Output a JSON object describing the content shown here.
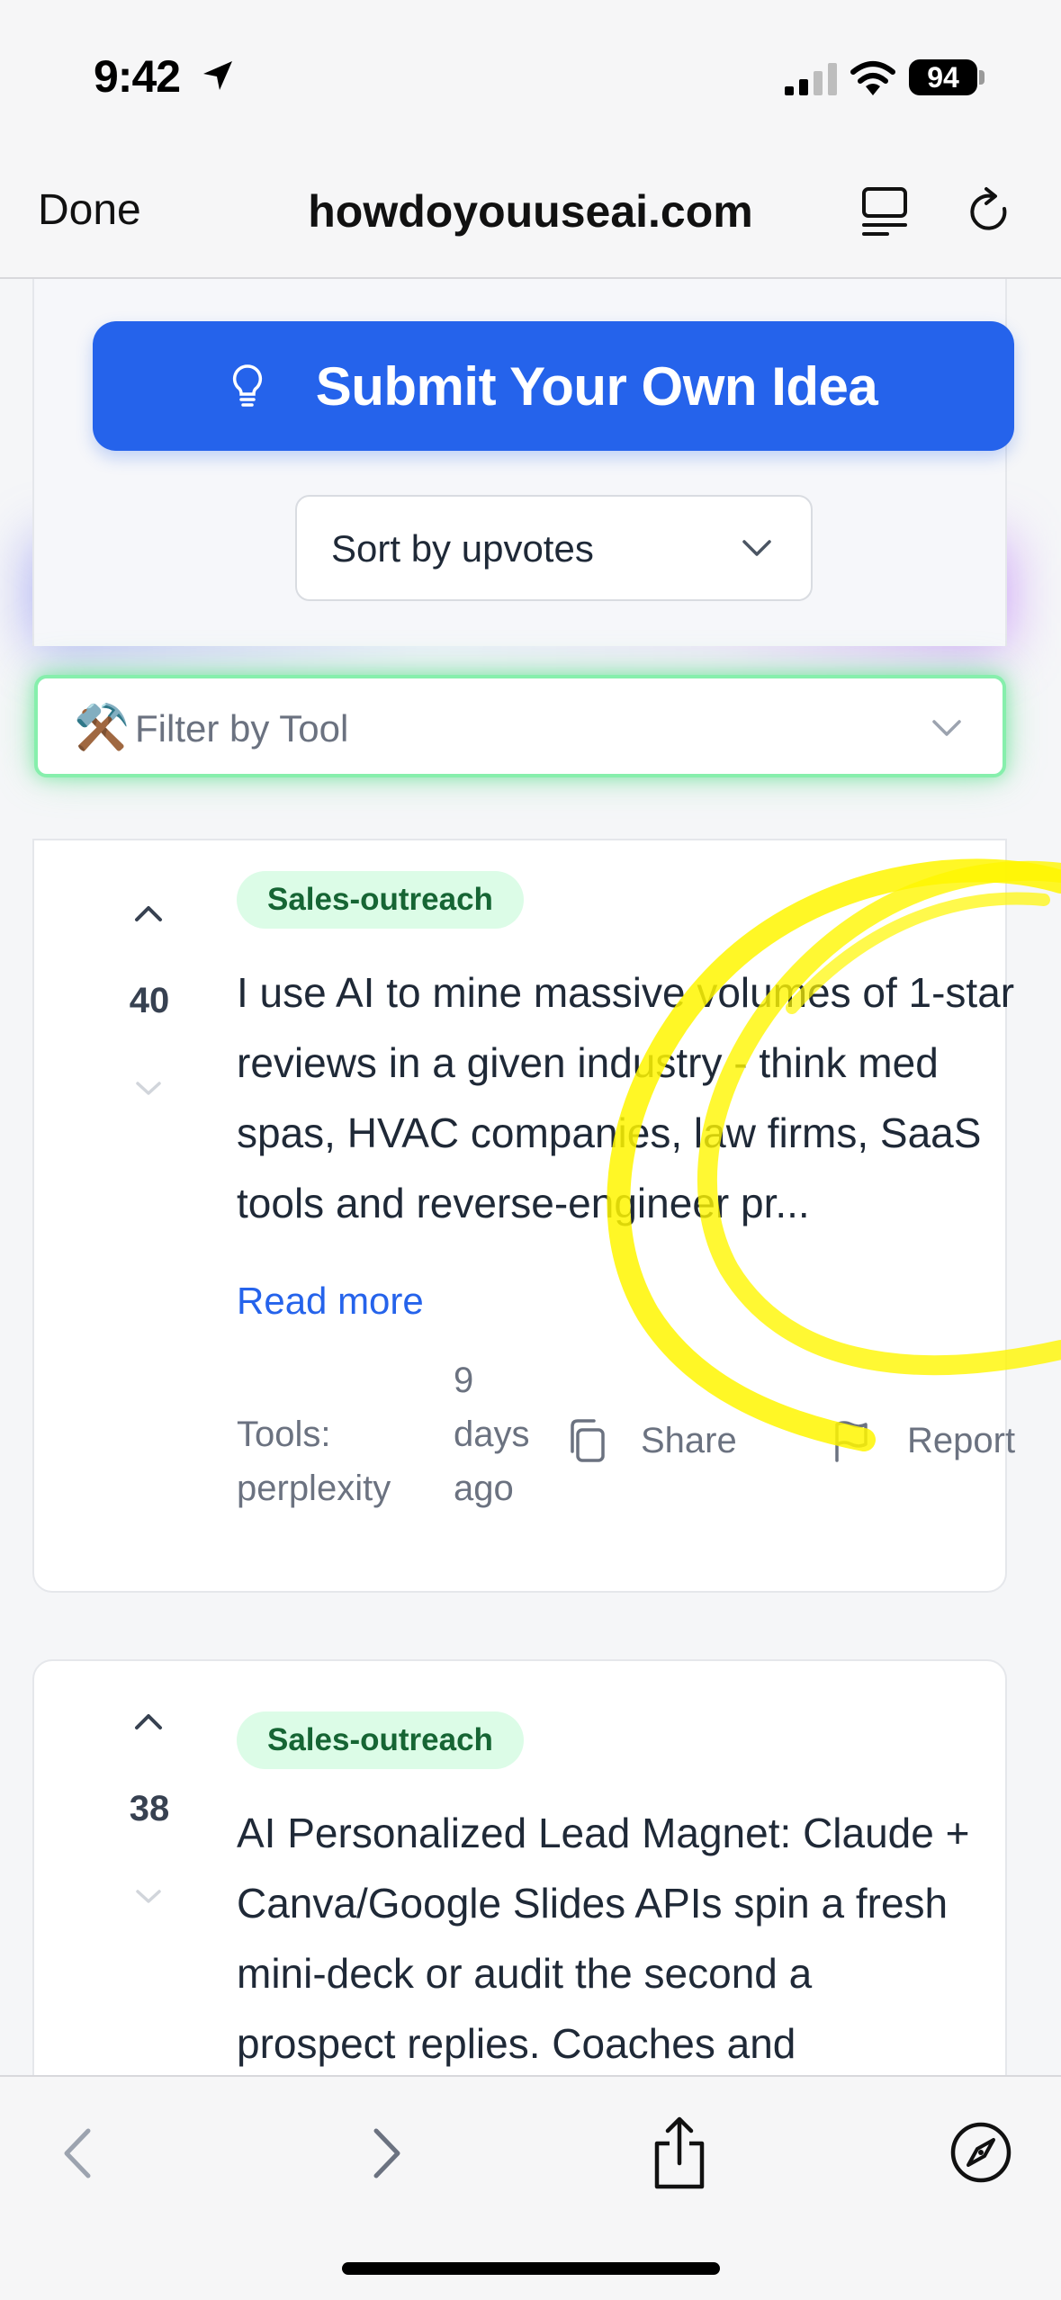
{
  "status_bar": {
    "time": "9:42",
    "battery": "94",
    "location_icon": "location-arrow-icon",
    "signal_icon": "cellular-signal-icon",
    "wifi_icon": "wifi-icon"
  },
  "browser": {
    "done_label": "Done",
    "url": "howdoyouuseai.com",
    "reader_icon": "reader-view-icon",
    "reload_icon": "reload-icon"
  },
  "submit": {
    "label": "Submit Your Own Idea",
    "icon": "lightbulb-icon",
    "color": "#2563eb"
  },
  "sort": {
    "selected": "Sort by upvotes"
  },
  "filter": {
    "emoji": "⚒️",
    "placeholder": "Filter by Tool",
    "accent_color": "#86efac"
  },
  "posts": [
    {
      "votes": "40",
      "tag": "Sales-outreach",
      "lines": [
        "I use AI to mine massive volumes of 1-star",
        "reviews in a given industry - think med",
        "spas, HVAC companies, law firms, SaaS",
        "tools and reverse-engineer pr..."
      ],
      "read_more": "Read more",
      "tools_label": "Tools:",
      "tools_value": "perplexity",
      "date_lines": [
        "9",
        "days",
        "ago"
      ],
      "share_label": "Share",
      "report_label": "Report"
    },
    {
      "votes": "38",
      "tag": "Sales-outreach",
      "lines": [
        "AI Personalized Lead Magnet: Claude +",
        "Canva/Google Slides APIs spin a fresh",
        "mini-deck or audit the second a",
        "prospect replies. Coaches and"
      ]
    }
  ],
  "toolbar": {
    "back_icon": "back-chevron-icon",
    "forward_icon": "forward-chevron-icon",
    "share_icon": "share-icon",
    "compass_icon": "compass-icon"
  },
  "annotation_color": "#ffff00"
}
